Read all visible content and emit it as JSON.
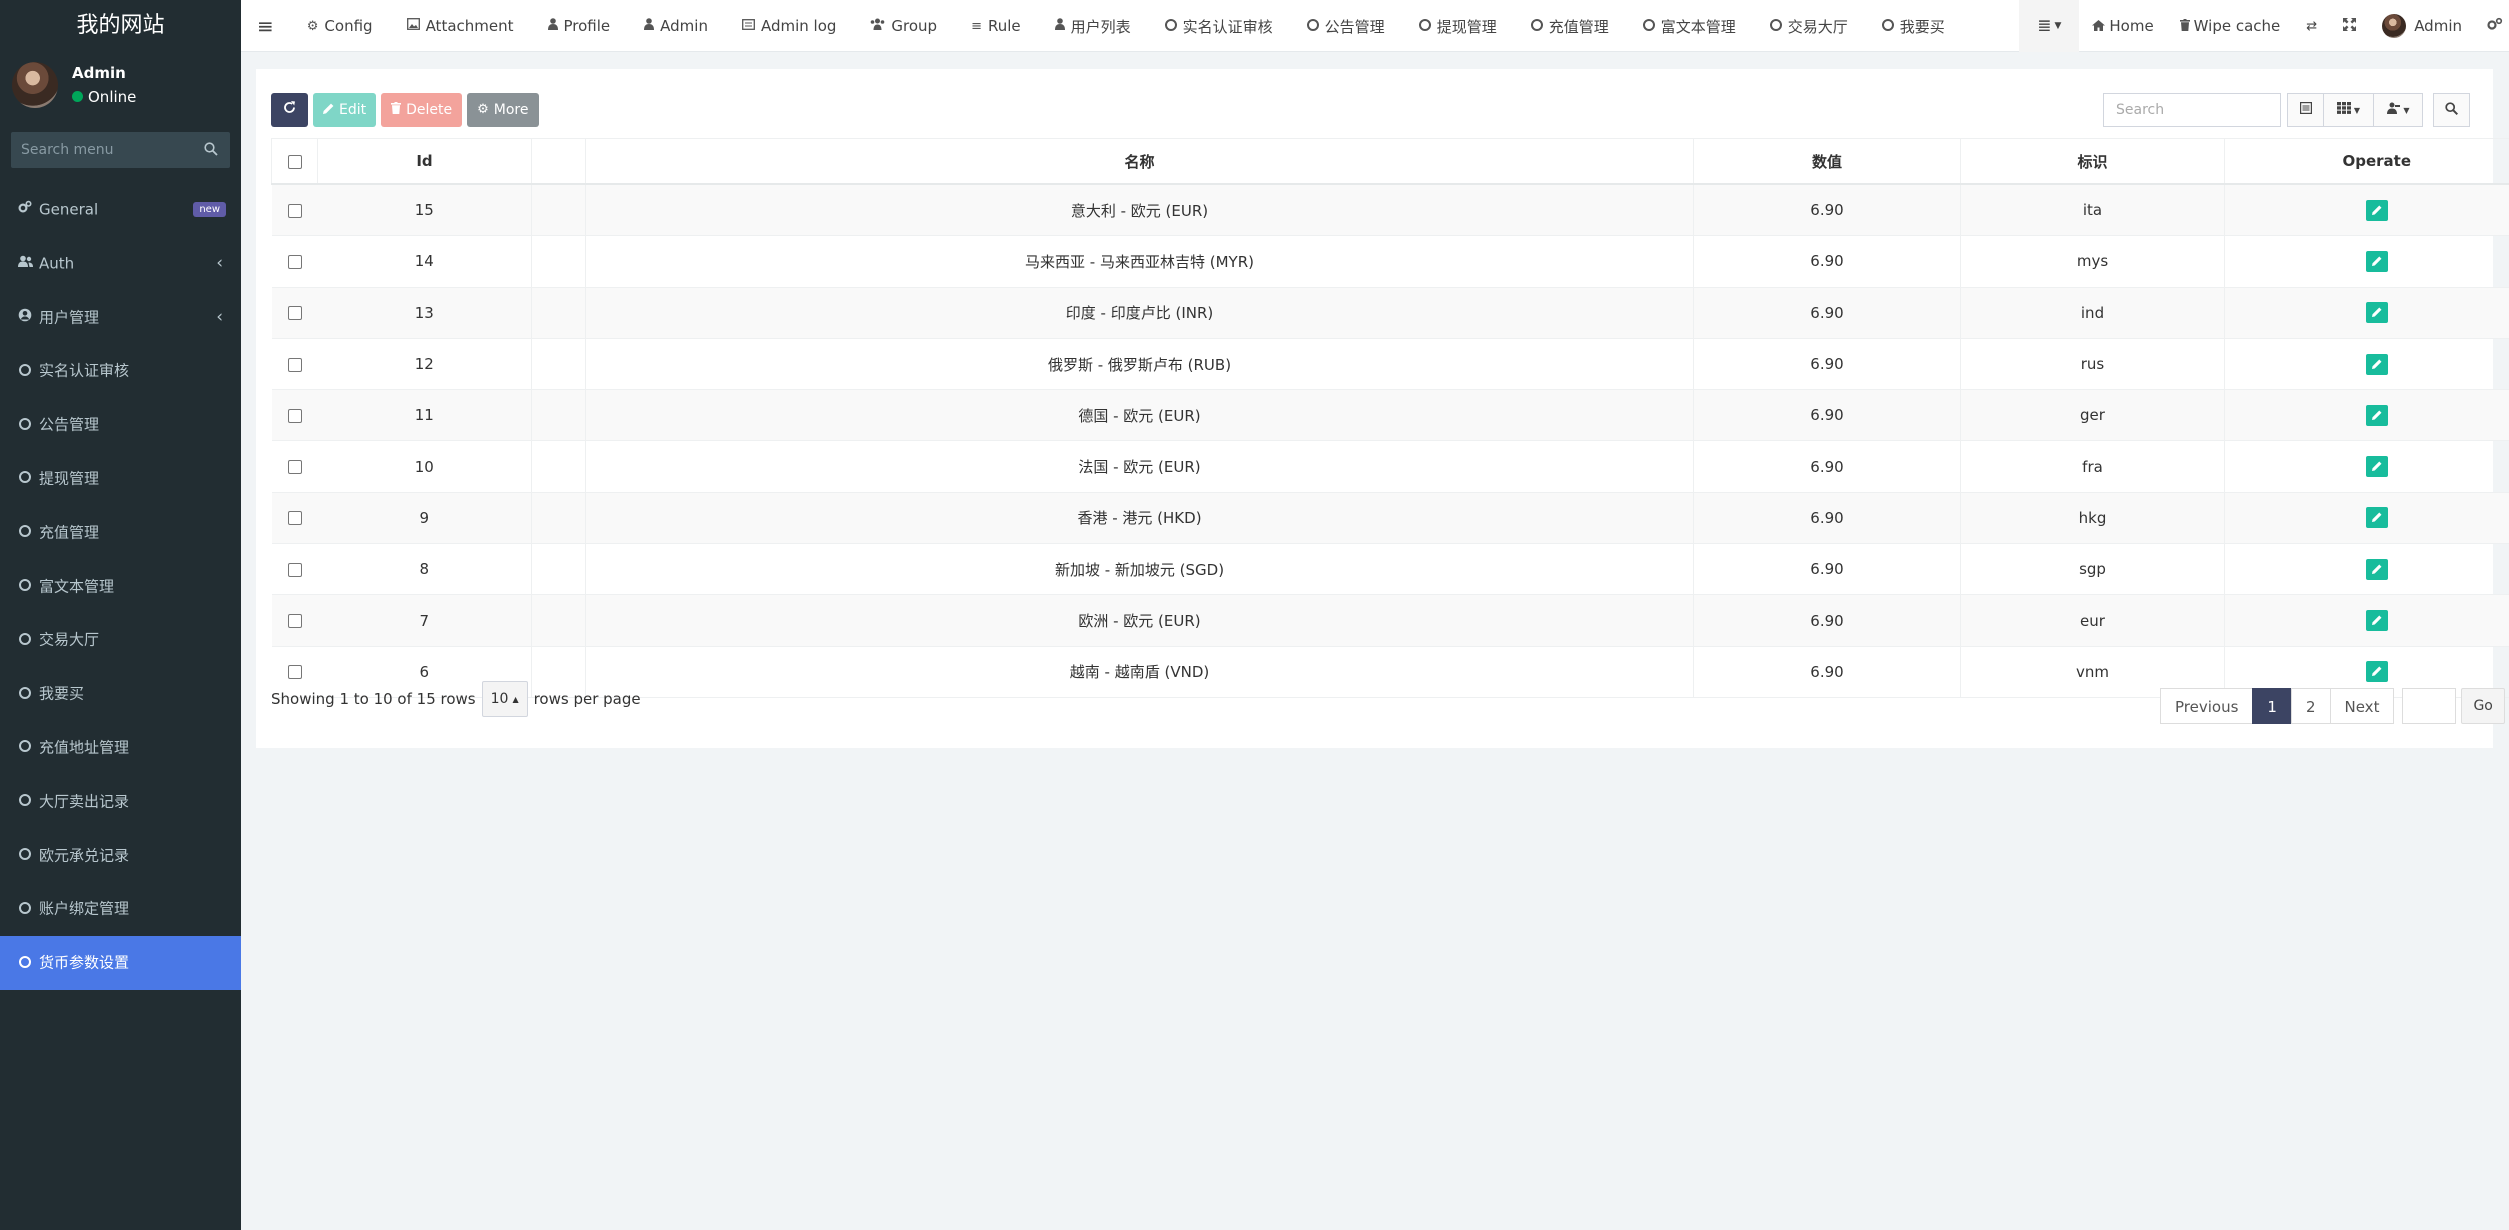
{
  "site": {
    "title": "我的网站"
  },
  "user": {
    "name": "Admin",
    "status": "Online"
  },
  "sidebar": {
    "search_placeholder": "Search menu",
    "items": [
      {
        "label": "General",
        "badge": "new",
        "icon": "cogs-icon"
      },
      {
        "label": "Auth",
        "icon": "users-icon",
        "has_children": true
      },
      {
        "label": "用户管理",
        "icon": "user-circle-icon",
        "has_children": true
      },
      {
        "label": "实名认证审核",
        "icon": "circle-o-icon"
      },
      {
        "label": "公告管理",
        "icon": "circle-o-icon"
      },
      {
        "label": "提现管理",
        "icon": "circle-o-icon"
      },
      {
        "label": "充值管理",
        "icon": "circle-o-icon"
      },
      {
        "label": "富文本管理",
        "icon": "circle-o-icon"
      },
      {
        "label": "交易大厅",
        "icon": "circle-o-icon"
      },
      {
        "label": "我要买",
        "icon": "circle-o-icon"
      },
      {
        "label": "充值地址管理",
        "icon": "circle-o-icon"
      },
      {
        "label": "大厅卖出记录",
        "icon": "circle-o-icon"
      },
      {
        "label": "欧元承兑记录",
        "icon": "circle-o-icon"
      },
      {
        "label": "账户绑定管理",
        "icon": "circle-o-icon"
      },
      {
        "label": "货币参数设置",
        "icon": "circle-o-icon",
        "active": true
      }
    ]
  },
  "topnav": {
    "items": [
      {
        "label": "Config",
        "icon": "gear-icon"
      },
      {
        "label": "Attachment",
        "icon": "image-icon"
      },
      {
        "label": "Profile",
        "icon": "user-icon"
      },
      {
        "label": "Admin",
        "icon": "user-icon"
      },
      {
        "label": "Admin log",
        "icon": "list-alt-icon"
      },
      {
        "label": "Group",
        "icon": "group-icon"
      },
      {
        "label": "Rule",
        "icon": "bars-icon"
      },
      {
        "label": "用户列表",
        "icon": "user-icon"
      },
      {
        "label": "实名认证审核",
        "icon": "circle-o-icon"
      },
      {
        "label": "公告管理",
        "icon": "circle-o-icon"
      },
      {
        "label": "提现管理",
        "icon": "circle-o-icon"
      },
      {
        "label": "充值管理",
        "icon": "circle-o-icon"
      },
      {
        "label": "富文本管理",
        "icon": "circle-o-icon"
      },
      {
        "label": "交易大厅",
        "icon": "circle-o-icon"
      },
      {
        "label": "我要买",
        "icon": "circle-o-icon"
      }
    ],
    "right": {
      "home": "Home",
      "wipe_cache": "Wipe cache",
      "admin": "Admin"
    }
  },
  "toolbar": {
    "edit": "Edit",
    "delete": "Delete",
    "more": "More",
    "search_placeholder": "Search"
  },
  "table": {
    "columns": [
      "Id",
      "名称",
      "数值",
      "标识",
      "Operate"
    ],
    "rows": [
      {
        "id": "15",
        "name": "意大利 - 欧元 (EUR)",
        "value": "6.90",
        "code": "ita"
      },
      {
        "id": "14",
        "name": "马来西亚 - 马来西亚林吉特 (MYR)",
        "value": "6.90",
        "code": "mys"
      },
      {
        "id": "13",
        "name": "印度 - 印度卢比 (INR)",
        "value": "6.90",
        "code": "ind"
      },
      {
        "id": "12",
        "name": "俄罗斯 - 俄罗斯卢布 (RUB)",
        "value": "6.90",
        "code": "rus"
      },
      {
        "id": "11",
        "name": "德国 - 欧元 (EUR)",
        "value": "6.90",
        "code": "ger"
      },
      {
        "id": "10",
        "name": "法国 - 欧元 (EUR)",
        "value": "6.90",
        "code": "fra"
      },
      {
        "id": "9",
        "name": "香港 - 港元 (HKD)",
        "value": "6.90",
        "code": "hkg"
      },
      {
        "id": "8",
        "name": "新加坡 - 新加坡元 (SGD)",
        "value": "6.90",
        "code": "sgp"
      },
      {
        "id": "7",
        "name": "欧洲 - 欧元 (EUR)",
        "value": "6.90",
        "code": "eur"
      },
      {
        "id": "6",
        "name": "越南 - 越南盾 (VND)",
        "value": "6.90",
        "code": "vnm"
      }
    ]
  },
  "pagination": {
    "summary": "Showing 1 to 10 of 15 rows",
    "page_size": "10",
    "rows_per_page": "rows per page",
    "previous": "Previous",
    "pages": [
      "1",
      "2"
    ],
    "current": "1",
    "next": "Next",
    "go": "Go"
  },
  "colors": {
    "sidebar_bg": "#222d32",
    "active_item": "#4a78e6",
    "primary": "#3c4463",
    "success": "#18bc9c"
  }
}
